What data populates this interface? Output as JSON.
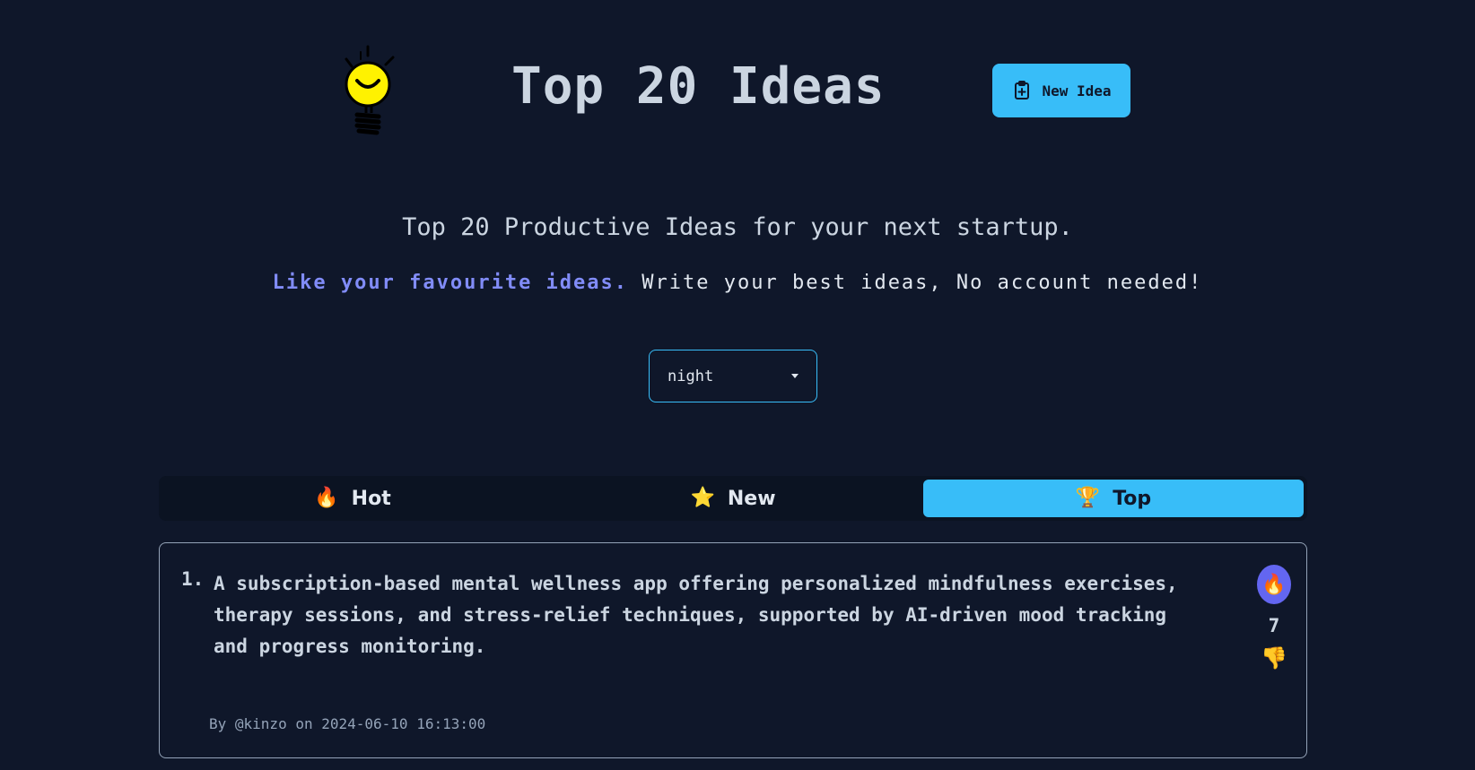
{
  "header": {
    "title": "Top 20 Ideas",
    "new_idea_label": "New Idea"
  },
  "intro": {
    "subtitle": "Top 20 Productive Ideas for your next startup.",
    "tagline_accent": "Like your favourite ideas.",
    "tagline_rest": " Write your best ideas, No account needed!"
  },
  "theme_select": {
    "value": "night"
  },
  "tabs": [
    {
      "icon": "fire-icon",
      "glyph": "🔥",
      "label": "Hot",
      "active": false
    },
    {
      "icon": "star-icon",
      "glyph": "⭐",
      "label": "New",
      "active": false
    },
    {
      "icon": "trophy-icon",
      "glyph": "🏆",
      "label": "Top",
      "active": true
    }
  ],
  "ideas": [
    {
      "rank": "1.",
      "text": "A subscription-based mental wellness app offering personalized mindfulness exercises, therapy sessions, and stress-relief techniques, supported by AI-driven mood tracking and progress monitoring.",
      "meta": "By @kinzo on 2024-06-10 16:13:00",
      "upvote_glyph": "🔥",
      "votes": "7",
      "downvote_glyph": "👎"
    }
  ],
  "colors": {
    "background": "#0f172a",
    "accent": "#38bdf8",
    "tagline_accent": "#818cf8",
    "upvote_bg": "#6366f1"
  }
}
